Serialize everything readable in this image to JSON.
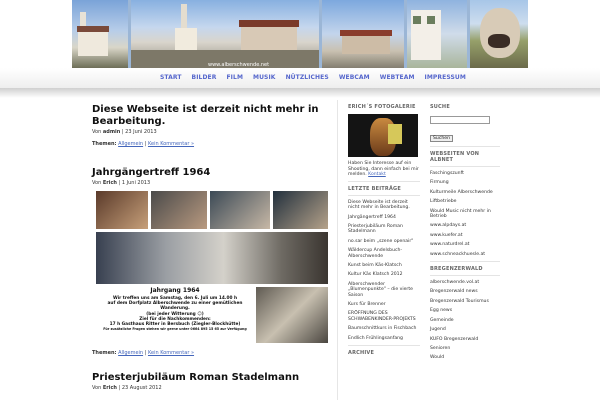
{
  "banner": {
    "url_text": "www.alberschwende.net"
  },
  "nav": [
    "START",
    "BILDER",
    "FILM",
    "MUSIK",
    "NÜTZLICHES",
    "WEBCAM",
    "WEBTEAM",
    "IMPRESSUM"
  ],
  "posts": [
    {
      "title": "Diese Webseite ist derzeit nicht mehr in Bearbeitung.",
      "meta_prefix": "Von",
      "author": "admin",
      "date": "23 Juni 2013",
      "themes_label": "Themen:",
      "category": "Allgemein",
      "comment": "Kein Kommentar »"
    },
    {
      "title": "Jahrgängertreff 1964",
      "meta_prefix": "Von",
      "author": "Erich",
      "date": "1 Juni 2013",
      "poster_title": "Jahrgang 1964",
      "poster_lines": [
        "Wir treffen uns am Samstag, den 6. Juli um 14.00 h",
        "auf dem Dorfplatz Alberschwende zu einer gemütlichen Wanderung.",
        "(bei jeder Witterung ☺)",
        "Ziel für die Nachkommenden:",
        "17 h Gasthaus Ritter in Bersbuch (Ziegler-Blockhütte)",
        "Für zusätzliche Fragen stehen wir gerne unter 0664 895 15 65 zur Verfügung"
      ],
      "themes_label": "Themen:",
      "category": "Allgemein",
      "comment": "Kein Kommentar »"
    },
    {
      "title": "Priesterjubiläum Roman Stadelmann",
      "meta_prefix": "Von",
      "author": "Erich",
      "date": "23 August 2012"
    }
  ],
  "sidebar1": {
    "gallery_heading": "ERICH´S FOTOGALERIE",
    "gallery_text": "Haben Sie Interesse auf ein Shooting, dann einfach bei mir melden.",
    "gallery_link": "Kontakt",
    "recent_heading": "LETZTE BEITRÄGE",
    "recent": [
      "Diese Webseite ist derzeit nicht mehr in Bearbeitung.",
      "Jahrgängertreff 1964",
      "Priesterjubiläum Roman Stadelmann",
      "no.sar beim „szene openair\"",
      "Wäldercup Andelsbuch-Alberschwende",
      "Kunst beim Käs-Klatsch",
      "Kultur Käs Klatsch 2012",
      "Alberschwender „Blumenpunkte\" – die vierte Saison",
      "Kurs für Brenner",
      "ERÖFFNUNG DES SCHWABENKINDER-PROJEKTS",
      "Baumschnittkurs in Fischbach",
      "Endlich Frühlingsanfang"
    ],
    "archive_heading": "ARCHIVE"
  },
  "sidebar2": {
    "search_heading": "SUCHE",
    "search_button": "Suchen",
    "webseiten_heading": "WEBSEITEN VON ALBNET",
    "webseiten": [
      "Faschingszunft",
      "Firmung",
      "Kulturmeile Alberschwende",
      "Liftbetriebe",
      "Would Music nicht mehr in Betrieb",
      "www.alpdays.at",
      "www.kuefer.at",
      "www.naturdrel.at",
      "www.schneackhuesle.at"
    ],
    "bregenzerwald_heading": "BREGENZERWALD",
    "bregenzerwald": [
      "alberschwende.vol.at",
      "Bregenzerwald news",
      "Bregenzerwald Tourismus",
      "Egg news",
      "Gemeinde",
      "Jugend",
      "KUFO Bregenzerwald",
      "Senioren",
      "Would"
    ]
  },
  "colors": {
    "nav": "#5566cc",
    "link": "#4466bb"
  }
}
